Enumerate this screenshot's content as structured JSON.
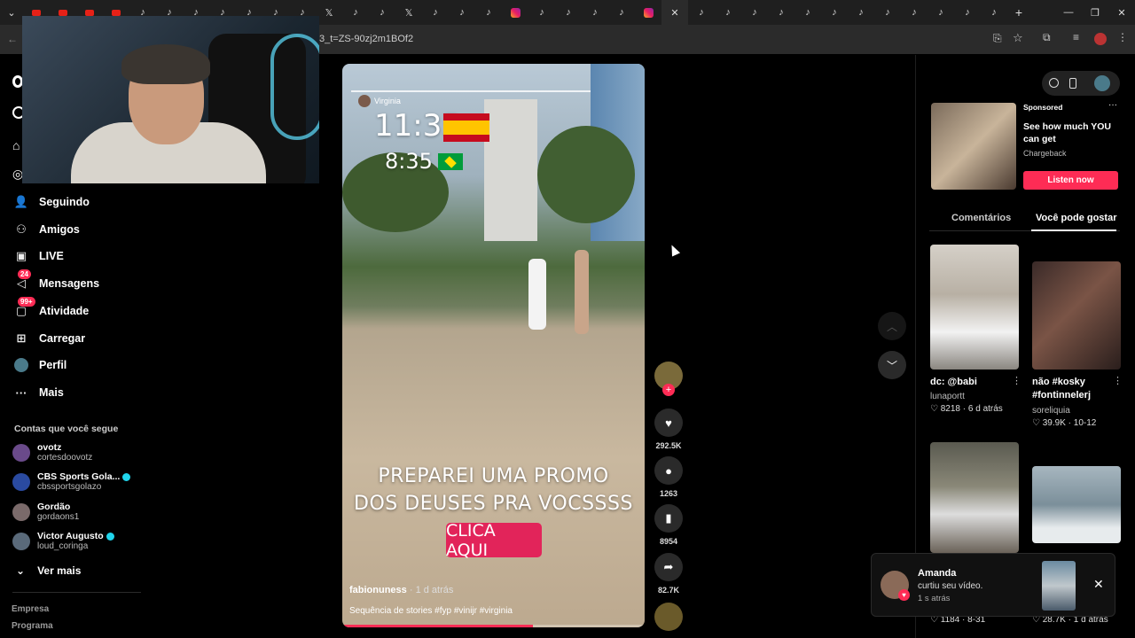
{
  "browser": {
    "url": "3_t=ZS-90zj2m1BOf2",
    "tabs": [
      "yt",
      "yt",
      "yt",
      "yt",
      "tt",
      "tt",
      "tt",
      "tt",
      "tt",
      "tt",
      "tt",
      "x",
      "tt",
      "tt",
      "x",
      "tt",
      "tt",
      "tt",
      "ig",
      "tt",
      "tt",
      "tt",
      "tt",
      "ig",
      "close",
      "tt",
      "tt",
      "tt",
      "tt",
      "tt",
      "tt",
      "tt",
      "tt",
      "tt",
      "tt",
      "tt",
      "tt"
    ]
  },
  "sidebar": {
    "nav": [
      {
        "label": "Seguindo",
        "icon": "following-icon"
      },
      {
        "label": "Amigos",
        "icon": "friends-icon"
      },
      {
        "label": "LIVE",
        "icon": "live-icon"
      },
      {
        "label": "Mensagens",
        "icon": "messages-icon",
        "badge": "24"
      },
      {
        "label": "Atividade",
        "icon": "activity-icon",
        "badge": "99+"
      },
      {
        "label": "Carregar",
        "icon": "upload-icon"
      },
      {
        "label": "Perfil",
        "icon": "profile-icon"
      },
      {
        "label": "Mais",
        "icon": "more-icon"
      }
    ],
    "following_title": "Contas que você segue",
    "accounts": [
      {
        "name": "ovotz",
        "handle": "cortesdoovotz",
        "verified": false
      },
      {
        "name": "CBS Sports Gola...",
        "handle": "cbssportsgolazo",
        "verified": true
      },
      {
        "name": "Gordão",
        "handle": "gordaons1",
        "verified": false
      },
      {
        "name": "Victor Augusto",
        "handle": "loud_coringa",
        "verified": true
      }
    ],
    "see_more": "Ver mais",
    "footer": [
      "Empresa",
      "Programa"
    ]
  },
  "video": {
    "story_user": "Virginia",
    "time1": "11:35",
    "time2": "8:35",
    "promo_line1": "PREPAREI UMA PROMO",
    "promo_line2": "DOS DEUSES PRA VOCSSSS",
    "cta": "CLICA AQUI",
    "author": "fabionuness",
    "posted": "· 1 d atrás",
    "caption": "Sequência de stories #fyp #vinijr #virginia",
    "progress": 0.63
  },
  "actions": {
    "likes": "292.5K",
    "comments": "1263",
    "saves": "8954",
    "shares": "82.7K"
  },
  "right_panel": {
    "ad": {
      "label": "Sponsored",
      "title": "See how much YOU can get",
      "brand": "Chargeback",
      "cta": "Listen now"
    },
    "tabs": [
      "Comentários",
      "Você pode gostar"
    ],
    "cards": [
      {
        "title": "dc: @babi",
        "user": "lunaportt",
        "likes": "8218",
        "date": "6 d atrás"
      },
      {
        "title": "não #kosky #fontinnelerj",
        "user": "soreliquia",
        "likes": "39.9K",
        "date": "10-12"
      },
      {
        "likes": "1184",
        "date": "8-31"
      },
      {
        "likes": "28.7K",
        "date": "1 d atrás"
      }
    ]
  },
  "notification": {
    "name": "Amanda",
    "text": "curtiu seu vídeo.",
    "time": "1 s atrás"
  },
  "colors": {
    "accent": "#fe2c55",
    "bg": "#000000",
    "verified": "#20d5ec"
  }
}
